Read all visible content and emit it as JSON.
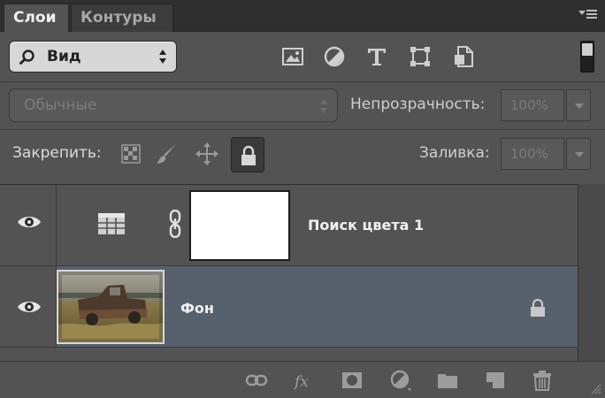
{
  "tabs": [
    {
      "label": "Слои",
      "active": true
    },
    {
      "label": "Контуры",
      "active": false
    }
  ],
  "filter": {
    "selected": "Вид",
    "icons": [
      "image-filter-icon",
      "adjustment-filter-icon",
      "type-filter-icon",
      "shape-filter-icon",
      "smart-object-filter-icon"
    ]
  },
  "blend": {
    "mode": "Обычные",
    "opacity_label": "Непрозрачность:",
    "opacity_value": "100%"
  },
  "lock": {
    "label": "Закрепить:",
    "fill_label": "Заливка:",
    "fill_value": "100%"
  },
  "layers": [
    {
      "name": "Поиск цвета 1",
      "visible": true,
      "type": "adjustment",
      "selected": false
    },
    {
      "name": "Фон",
      "visible": true,
      "type": "background",
      "selected": true,
      "locked": true
    }
  ],
  "bottom_icons": [
    "link-layers-icon",
    "fx-icon",
    "layer-mask-icon",
    "adjustment-layer-icon",
    "new-group-icon",
    "new-layer-icon",
    "trash-icon"
  ],
  "colors": {
    "panel_bg": "#535353",
    "selected_row": "#57606d",
    "tabbar_bg": "#2f2f2f"
  }
}
